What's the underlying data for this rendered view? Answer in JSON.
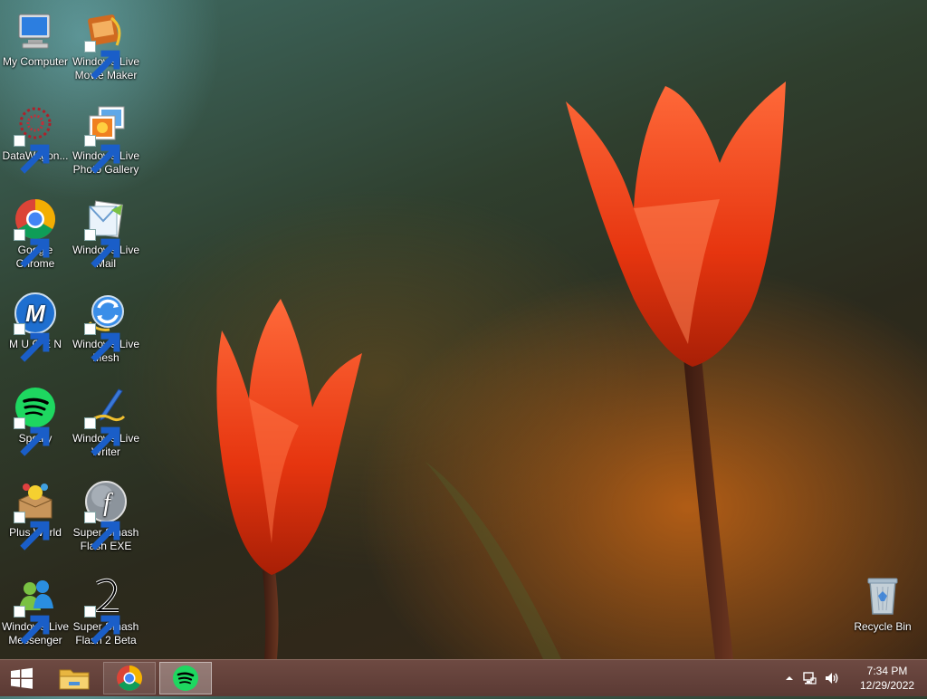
{
  "desktop": {
    "left_column": [
      {
        "label": "My Computer",
        "icon": "computer-icon"
      },
      {
        "label": "DataWagon...",
        "icon": "datawagon-icon"
      },
      {
        "label": "Google Chrome",
        "icon": "chrome-icon"
      },
      {
        "label": "M U G E N",
        "icon": "mugen-icon"
      },
      {
        "label": "Spotify",
        "icon": "spotify-icon"
      },
      {
        "label": "Plus World",
        "icon": "plus-world-icon"
      },
      {
        "label": "Windows Live Messenger",
        "icon": "messenger-icon"
      }
    ],
    "right_column": [
      {
        "label": "Windows Live Movie Maker",
        "icon": "movie-maker-icon"
      },
      {
        "label": "Windows Live Photo Gallery",
        "icon": "photo-gallery-icon"
      },
      {
        "label": "Windows Live Mail",
        "icon": "mail-icon"
      },
      {
        "label": "Windows Live Mesh",
        "icon": "mesh-icon"
      },
      {
        "label": "Windows Live Writer",
        "icon": "writer-icon"
      },
      {
        "label": "Super Smash Flash EXE",
        "icon": "flash-icon"
      },
      {
        "label": "Super Smash Flash 2 Beta",
        "icon": "ssf2-icon"
      }
    ],
    "recycle_bin": {
      "label": "Recycle Bin",
      "icon": "recycle-bin-icon"
    }
  },
  "taskbar": {
    "start": {
      "icon": "windows-logo-icon"
    },
    "pinned": [
      {
        "name": "file-explorer",
        "icon": "folder-icon"
      },
      {
        "name": "chrome",
        "icon": "chrome-icon"
      },
      {
        "name": "spotify",
        "icon": "spotify-icon",
        "active": true
      }
    ],
    "tray": {
      "icons": [
        "show-hidden-icons-arrow",
        "network-icon",
        "volume-icon"
      ],
      "time": "7:34 PM",
      "date": "12/29/2022"
    }
  },
  "colors": {
    "taskbar": "#5f3d36",
    "tulip": "#e8441a",
    "spotify": "#1ed760"
  }
}
